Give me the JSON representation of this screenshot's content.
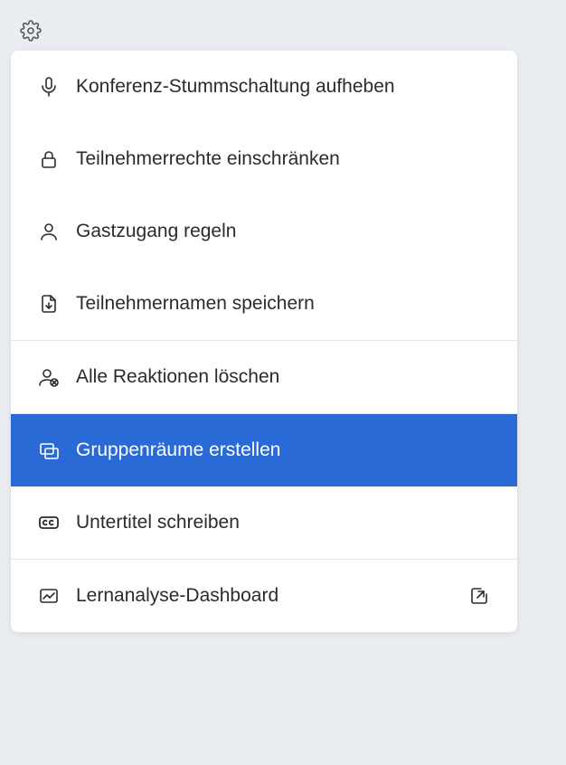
{
  "menu": {
    "items": [
      {
        "label": "Konferenz-Stummschaltung aufheben"
      },
      {
        "label": "Teilnehmerrechte einschränken"
      },
      {
        "label": "Gastzugang regeln"
      },
      {
        "label": "Teilnehmernamen speichern"
      },
      {
        "label": "Alle Reaktionen löschen"
      },
      {
        "label": "Gruppenräume erstellen"
      },
      {
        "label": "Untertitel schreiben"
      },
      {
        "label": "Lernanalyse-Dashboard"
      }
    ]
  }
}
